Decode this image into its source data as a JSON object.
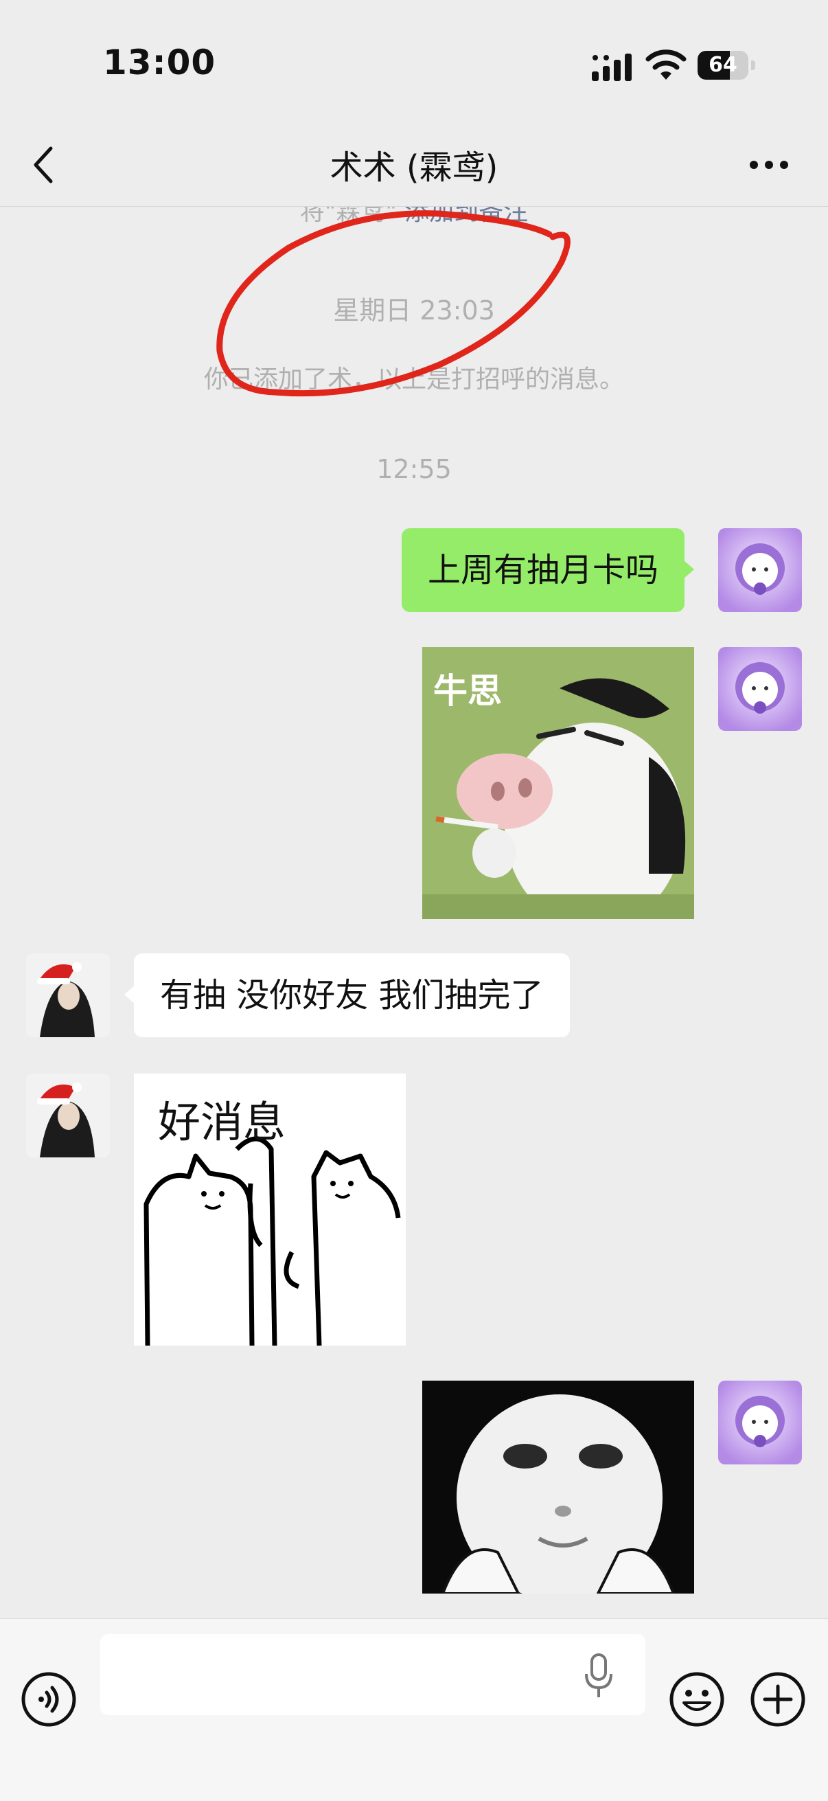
{
  "status_bar": {
    "time": "13:00",
    "battery": "64",
    "battery_fraction": 0.64
  },
  "nav": {
    "title": "术术 (霖鸢)"
  },
  "messages": {
    "remark_hint_prefix": "将\"霖鸢\"",
    "remark_hint_link": "添加到备注",
    "timestamp_1": "星期日 23:03",
    "greeting": "你已添加了术，以上是打招呼的消息。",
    "timestamp_2": "12:55",
    "outgoing_text_1": "上周有抽月卡吗",
    "sticker_cow_caption": "牛思",
    "incoming_text_1": "有抽  没你好友 我们抽完了",
    "sticker_cats_caption": "好消息"
  },
  "input_bar": {
    "placeholder": ""
  },
  "colors": {
    "outgoing_bubble": "#95ec69",
    "incoming_bubble": "#ffffff",
    "background": "#ededed",
    "annotation_circle": "#e0251b"
  }
}
